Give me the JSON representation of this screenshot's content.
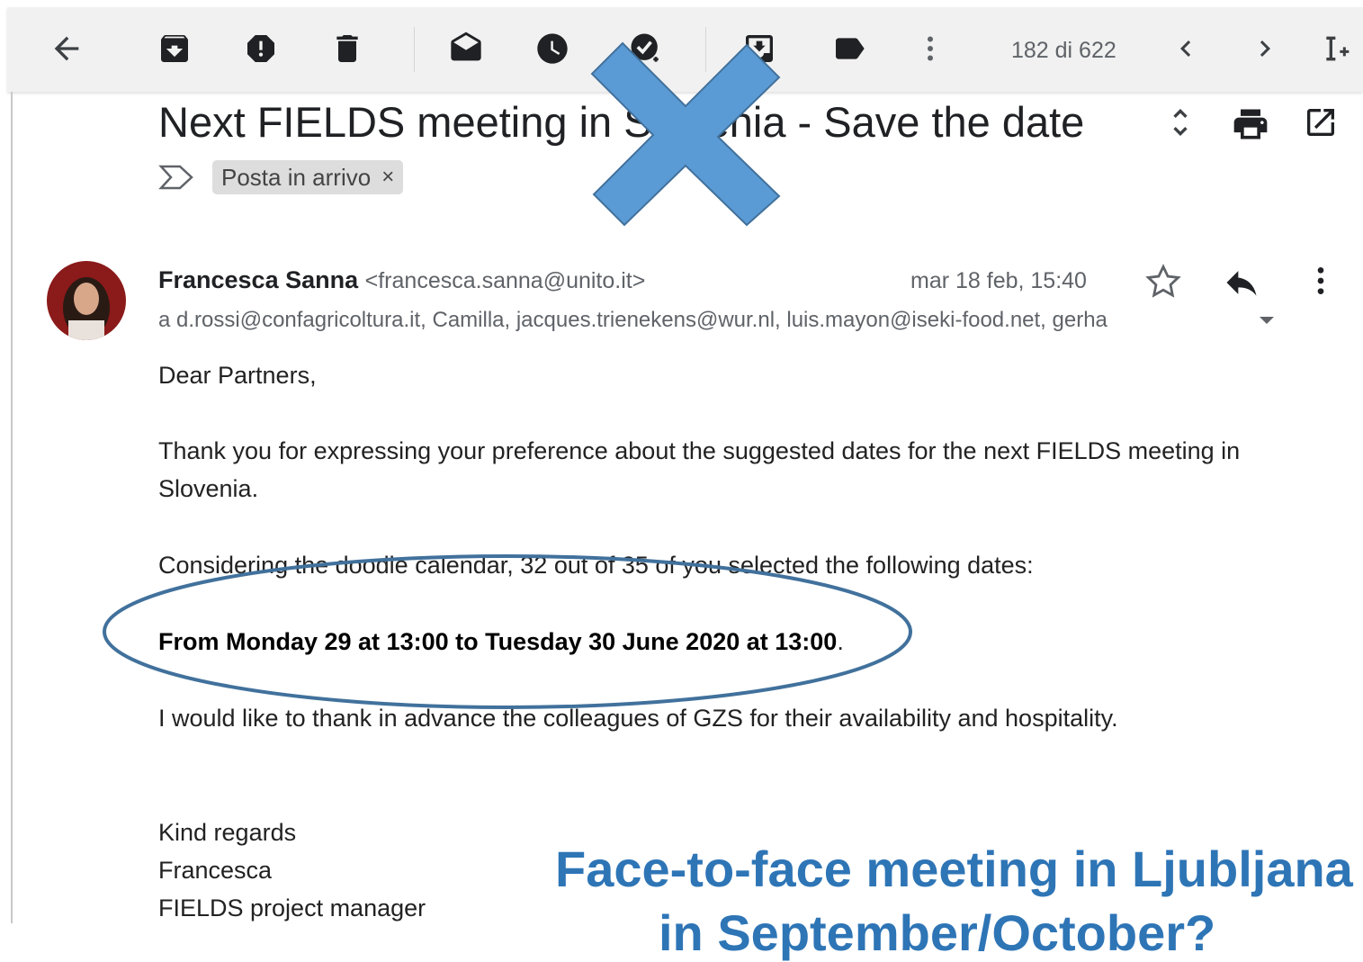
{
  "toolbar": {
    "counter": "182 di 622",
    "icons": [
      "back-arrow-icon",
      "archive-icon",
      "report-spam-icon",
      "delete-icon",
      "mark-unread-icon",
      "snooze-icon",
      "add-to-tasks-icon",
      "move-to-icon",
      "label-icon",
      "more-vert-icon",
      "prev-icon",
      "next-icon",
      "input-tools-icon"
    ]
  },
  "message": {
    "subject": "Next FIELDS meeting in Slovenia - Save the date",
    "label": "Posta in arrivo",
    "label_close": "×",
    "sender_name": "Francesca Sanna",
    "sender_email": "<francesca.sanna@unito.it>",
    "date": "mar 18 feb, 15:40",
    "recipients": "a d.rossi@confagricoltura.it, Camilla, jacques.trienekens@wur.nl, luis.mayon@iseki-food.net, gerha",
    "greeting": "Dear Partners,",
    "para1_line1": "Thank you for expressing your preference about the suggested dates for the next FIELDS meeting in",
    "para1_line2": "Slovenia.",
    "para2": "Considering the doodle calendar, 32 out of 35 of you selected the following dates:",
    "date_line_bold": "From Monday 29 at 13:00 to Tuesday 30 June 2020 at 13:00",
    "date_line_end": ".",
    "para3": "I would like to thank in advance the colleagues of GZS for their availability and hospitality.",
    "closing": "Kind regards",
    "sig_name": "Francesca",
    "sig_title": "FIELDS project manager"
  },
  "overlay": {
    "line1": "Face-to-face meeting in Ljubljana",
    "line2": "in September/October?",
    "cross_color": "#5b9bd5",
    "ellipse_color": "#41719c"
  },
  "colors": {
    "toolbar_bg": "#f1f1f1",
    "overlay_text": "#2e75b6",
    "label_bg": "#dddddd"
  }
}
